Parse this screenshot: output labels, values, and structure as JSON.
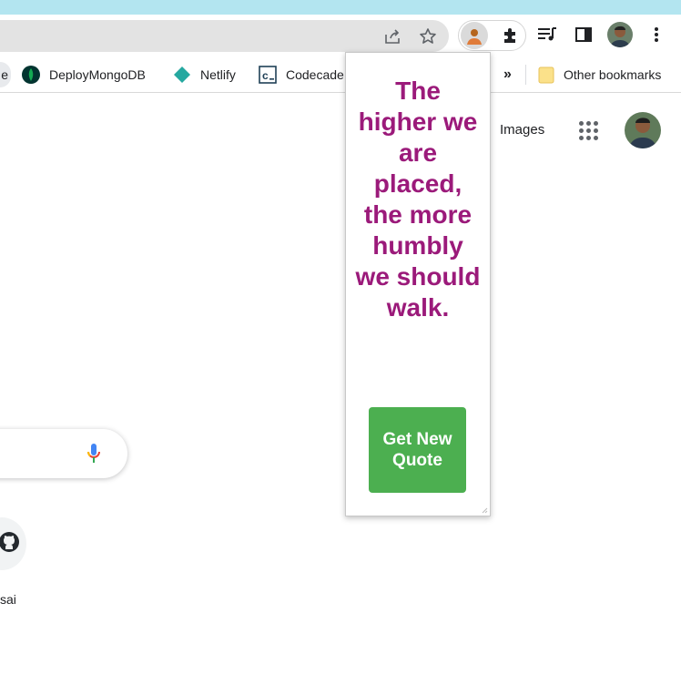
{
  "colors": {
    "top_strip": "#b3e5f0",
    "quote_text": "#9b1a7a",
    "button_bg": "#4caf50"
  },
  "toolbar": {
    "icons": [
      "share-icon",
      "star-icon",
      "profile-extension-icon",
      "puzzle-extensions-icon",
      "media-queue-icon",
      "side-panel-icon",
      "profile-avatar-icon",
      "kebab-menu-icon"
    ]
  },
  "bookmarks": {
    "left_partial": "e",
    "items": [
      {
        "label": "DeployMongoDB",
        "icon": "mongodb-leaf-icon"
      },
      {
        "label": "Netlify",
        "icon": "netlify-diamond-icon"
      },
      {
        "label": "Codecade",
        "icon": "codecademy-icon"
      }
    ],
    "overflow": "»",
    "other": "Other bookmarks"
  },
  "google": {
    "images_link": "Images",
    "shortcut_label": "sai"
  },
  "popup": {
    "quote": "The higher we are placed, the more humbly we should walk.",
    "button": "Get New Quote"
  }
}
